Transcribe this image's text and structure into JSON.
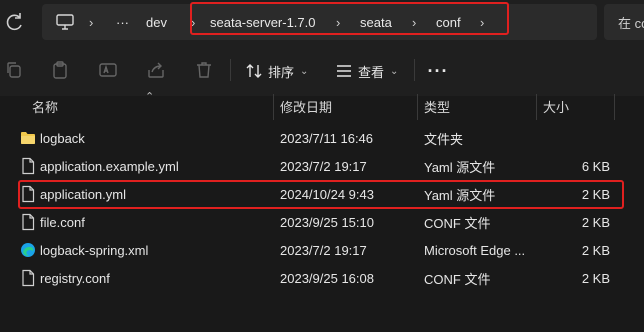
{
  "breadcrumb": {
    "more": "···",
    "items": [
      "dev",
      "seata-server-1.7.0",
      "seata",
      "conf"
    ]
  },
  "search": {
    "text": "在 co"
  },
  "toolbar": {
    "sort_label": "排序",
    "view_label": "查看",
    "more_label": "···"
  },
  "columns": {
    "name": "名称",
    "date": "修改日期",
    "type": "类型",
    "size": "大小"
  },
  "files": [
    {
      "name": "logback",
      "date": "2023/7/11 16:46",
      "type": "文件夹",
      "size": "",
      "icon": "folder-icon"
    },
    {
      "name": "application.example.yml",
      "date": "2023/7/2 19:17",
      "type": "Yaml 源文件",
      "size": "6 KB",
      "icon": "file-icon"
    },
    {
      "name": "application.yml",
      "date": "2024/10/24 9:43",
      "type": "Yaml 源文件",
      "size": "2 KB",
      "icon": "file-icon"
    },
    {
      "name": "file.conf",
      "date": "2023/9/25 15:10",
      "type": "CONF 文件",
      "size": "2 KB",
      "icon": "file-icon"
    },
    {
      "name": "logback-spring.xml",
      "date": "2023/7/2 19:17",
      "type": "Microsoft Edge ...",
      "size": "2 KB",
      "icon": "edge-icon"
    },
    {
      "name": "registry.conf",
      "date": "2023/9/25 16:08",
      "type": "CONF 文件",
      "size": "2 KB",
      "icon": "file-icon"
    }
  ],
  "colors": {
    "highlight": "#e0201f",
    "background": "#191919",
    "folder": "#f2c94c",
    "edge": "#1aa3e8"
  }
}
